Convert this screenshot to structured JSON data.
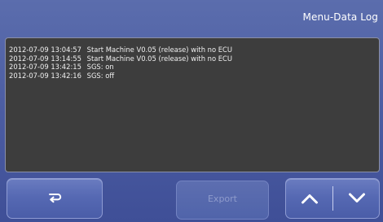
{
  "header": {
    "title": "Menu-Data Log"
  },
  "log": {
    "entries": [
      {
        "timestamp": "2012-07-09 13:04:57",
        "message": "Start Machine V0.05 (release) with no ECU"
      },
      {
        "timestamp": "2012-07-09 13:14:55",
        "message": "Start Machine V0.05 (release) with no ECU"
      },
      {
        "timestamp": "2012-07-09 13:42:15",
        "message": "SGS: on"
      },
      {
        "timestamp": "2012-07-09 13:42:16",
        "message": "SGS: off"
      }
    ]
  },
  "toolbar": {
    "back_icon": "return-arrow-icon",
    "export_label": "Export",
    "export_enabled": false,
    "up_icon": "chevron-up-icon",
    "down_icon": "chevron-down-icon"
  },
  "colors": {
    "frame": "#4a5ba1",
    "log_background": "#3d3d3d",
    "log_text": "#f0f0f0",
    "disabled_text": "#8f9bcb"
  }
}
